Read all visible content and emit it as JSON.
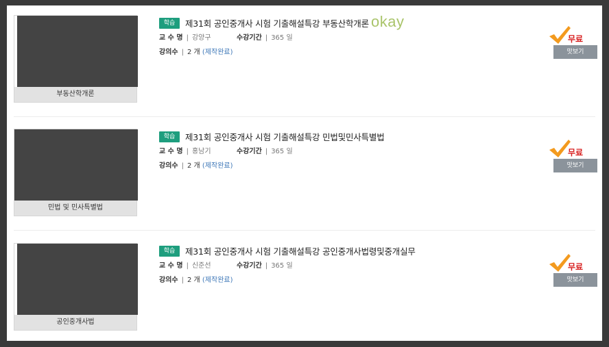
{
  "courses": [
    {
      "thumb_caption": "부동산학개론",
      "badge": "학습",
      "title": "제31회 공인중개사 시험 기출해설특강 부동산학개론",
      "okay_text": "okay",
      "professor_label": "교 수 명",
      "professor": "강양구",
      "period_label": "수강기간",
      "period": "365 일",
      "lectures_label": "강의수",
      "lectures": "2 개",
      "status": "(제작완료)",
      "price": "무료",
      "preview_label": "맛보기"
    },
    {
      "thumb_caption": "민법 및 민사특별법",
      "badge": "학습",
      "title": "제31회 공인중개사 시험 기출해설특강 민법및민사특별법",
      "professor_label": "교 수 명",
      "professor": "홍남기",
      "period_label": "수강기간",
      "period": "365 일",
      "lectures_label": "강의수",
      "lectures": "2 개",
      "status": "(제작완료)",
      "price": "무료",
      "preview_label": "맛보기"
    },
    {
      "thumb_caption": "공인중개사법",
      "badge": "학습",
      "title": "제31회 공인중개사 시험 기출해설특강 공인중개사법령및중개실무",
      "professor_label": "교 수 명",
      "professor": "신준선",
      "period_label": "수강기간",
      "period": "365 일",
      "lectures_label": "강의수",
      "lectures": "2 개",
      "status": "(제작완료)",
      "price": "무료",
      "preview_label": "맛보기"
    }
  ],
  "separator": "|",
  "colors": {
    "badge": "#1e9e7e",
    "price": "#d71c1c",
    "check": "#f39a1e",
    "okay": "#a9c46a",
    "status_link": "#3f78b8",
    "preview_button": "#8b939b"
  }
}
